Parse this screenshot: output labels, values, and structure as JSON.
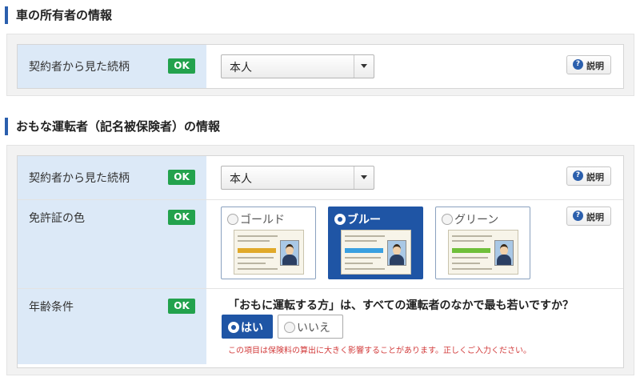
{
  "owner_section": {
    "title": "車の所有者の情報",
    "rows": [
      {
        "label": "契約者から見た続柄",
        "status": "OK",
        "select_value": "本人",
        "help": "説明"
      }
    ]
  },
  "driver_section": {
    "title": "おもな運転者（記名被保険者）の情報",
    "relation": {
      "label": "契約者から見た続柄",
      "status": "OK",
      "select_value": "本人",
      "help": "説明"
    },
    "license": {
      "label": "免許証の色",
      "status": "OK",
      "help": "説明",
      "options": [
        {
          "name": "ゴールド",
          "selected": false,
          "band_color": "#e0a92a"
        },
        {
          "name": "ブルー",
          "selected": true,
          "band_color": "#3aa0e0"
        },
        {
          "name": "グリーン",
          "selected": false,
          "band_color": "#6fbf3a"
        }
      ]
    },
    "age": {
      "label": "年齢条件",
      "status": "OK",
      "question": "「おもに運転する方」は、すべての運転者のなかで最も若いですか？",
      "options": [
        {
          "name": "はい",
          "selected": true
        },
        {
          "name": "いいえ",
          "selected": false
        }
      ],
      "note": "この項目は保険料の算出に大きく影響することがあります。正しくご入力ください。"
    }
  },
  "colors": {
    "accent": "#2b5fad",
    "ok": "#23a24d",
    "label_bg": "#dce9f7",
    "selected": "#1f55a5"
  }
}
